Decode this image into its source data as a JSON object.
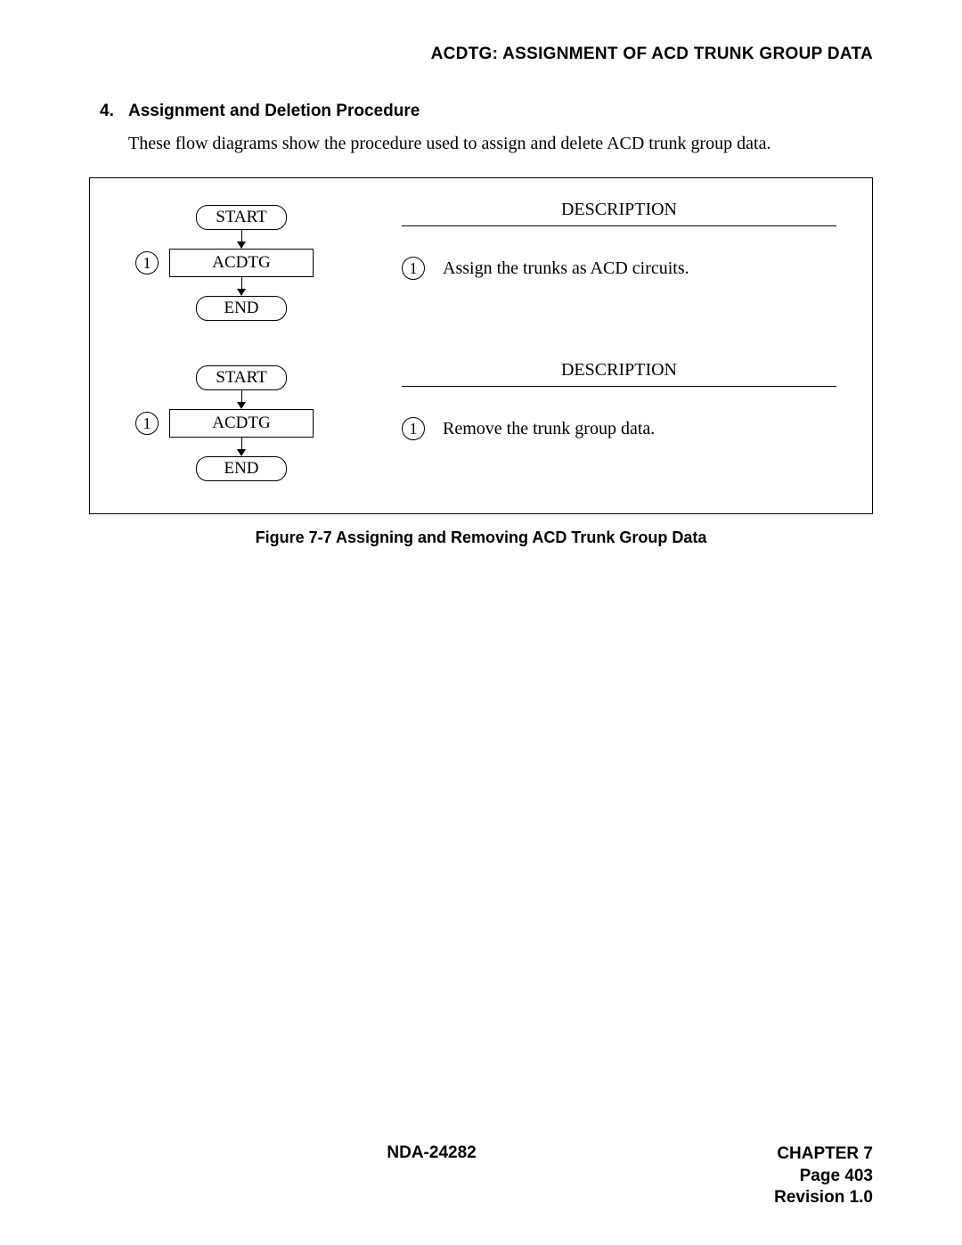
{
  "header": {
    "title": "ACDTG: ASSIGNMENT OF ACD TRUNK GROUP DATA"
  },
  "section": {
    "number": "4.",
    "title": "Assignment and Deletion Procedure",
    "intro": "These flow diagrams show the procedure used to assign and delete ACD trunk group data."
  },
  "flows": [
    {
      "start": "START",
      "step_num": "1",
      "step_label": "ACDTG",
      "end": "END",
      "desc_title": "DESCRIPTION",
      "desc_num": "1",
      "desc_text": "Assign the trunks as ACD circuits."
    },
    {
      "start": "START",
      "step_num": "1",
      "step_label": "ACDTG",
      "end": "END",
      "desc_title": "DESCRIPTION",
      "desc_num": "1",
      "desc_text": "Remove the trunk group data."
    }
  ],
  "figure_caption": "Figure 7-7   Assigning and Removing ACD Trunk Group Data",
  "footer": {
    "doc_id": "NDA-24282",
    "chapter": "CHAPTER 7",
    "page": "Page 403",
    "revision": "Revision 1.0"
  }
}
